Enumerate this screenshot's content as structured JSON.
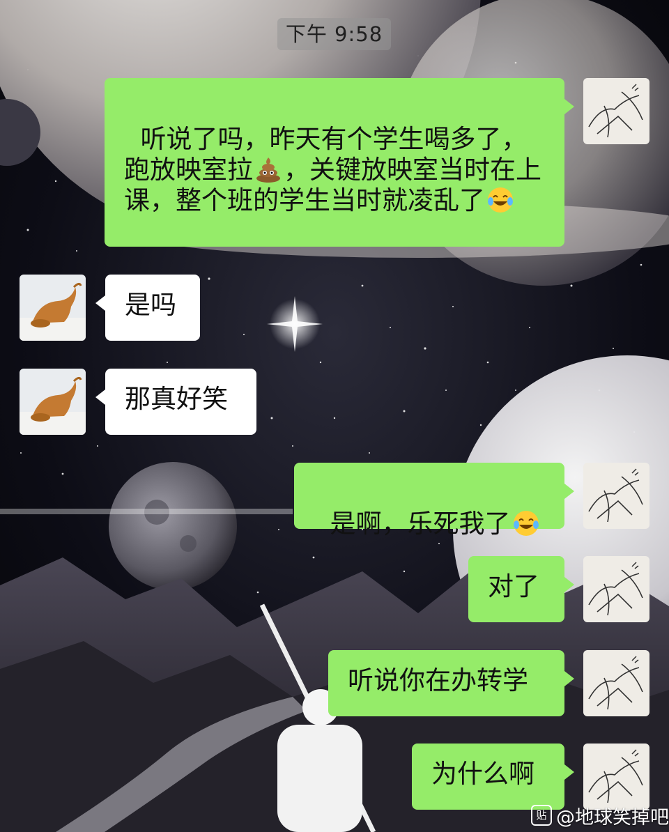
{
  "chat": {
    "timestamp": "下午 9:58",
    "messages": [
      {
        "side": "out",
        "parts": [
          {
            "t": "听说了吗，昨天有个学生喝多了，跑放映室拉"
          },
          {
            "emoji": "poop-emoji"
          },
          {
            "t": "，关键放映室当时在上课，整个班的学生当时就凌乱了"
          },
          {
            "emoji": "tears-of-joy-emoji"
          }
        ]
      },
      {
        "side": "in",
        "text": "是吗"
      },
      {
        "side": "in",
        "text": "那真好笑"
      },
      {
        "side": "out",
        "parts": [
          {
            "t": "是啊，乐死我了"
          },
          {
            "emoji": "tears-of-joy-emoji"
          }
        ]
      },
      {
        "side": "out",
        "text": "对了"
      },
      {
        "side": "out",
        "text": "听说你在办转学"
      },
      {
        "side": "out",
        "text": "为什么啊"
      }
    ]
  },
  "watermark": {
    "badge": "贴",
    "text": "@地球笑掉吧"
  },
  "colors": {
    "outgoing_bubble": "#95ec69",
    "incoming_bubble": "#ffffff",
    "timestamp_bg": "rgba(150,150,150,0.55)"
  }
}
